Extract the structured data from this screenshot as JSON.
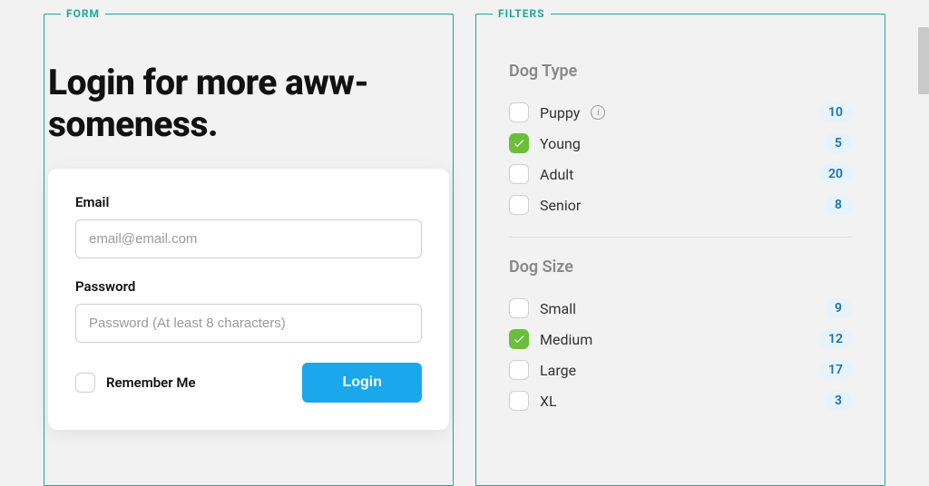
{
  "panels": {
    "form_legend": "FORM",
    "filters_legend": "FILTERS"
  },
  "form": {
    "headline": "Login for more aww-someness.",
    "email": {
      "label": "Email",
      "placeholder": "email@email.com",
      "value": ""
    },
    "password": {
      "label": "Password",
      "placeholder": "Password (At least 8 characters)",
      "value": ""
    },
    "remember": {
      "label": "Remember Me",
      "checked": false
    },
    "submit_label": "Login"
  },
  "filters": {
    "groups": [
      {
        "title": "Dog Type",
        "items": [
          {
            "label": "Puppy",
            "checked": false,
            "count": 10,
            "info": true
          },
          {
            "label": "Young",
            "checked": true,
            "count": 5
          },
          {
            "label": "Adult",
            "checked": false,
            "count": 20
          },
          {
            "label": "Senior",
            "checked": false,
            "count": 8
          }
        ]
      },
      {
        "title": "Dog Size",
        "items": [
          {
            "label": "Small",
            "checked": false,
            "count": 9
          },
          {
            "label": "Medium",
            "checked": true,
            "count": 12
          },
          {
            "label": "Large",
            "checked": false,
            "count": 17
          },
          {
            "label": "XL",
            "checked": false,
            "count": 3
          }
        ]
      }
    ]
  },
  "colors": {
    "accent_teal": "#1ea895",
    "accent_blue": "#1aa7ec",
    "check_green": "#6bbf3b",
    "badge_bg": "#e6f3fb",
    "badge_fg": "#1a6fb0"
  }
}
